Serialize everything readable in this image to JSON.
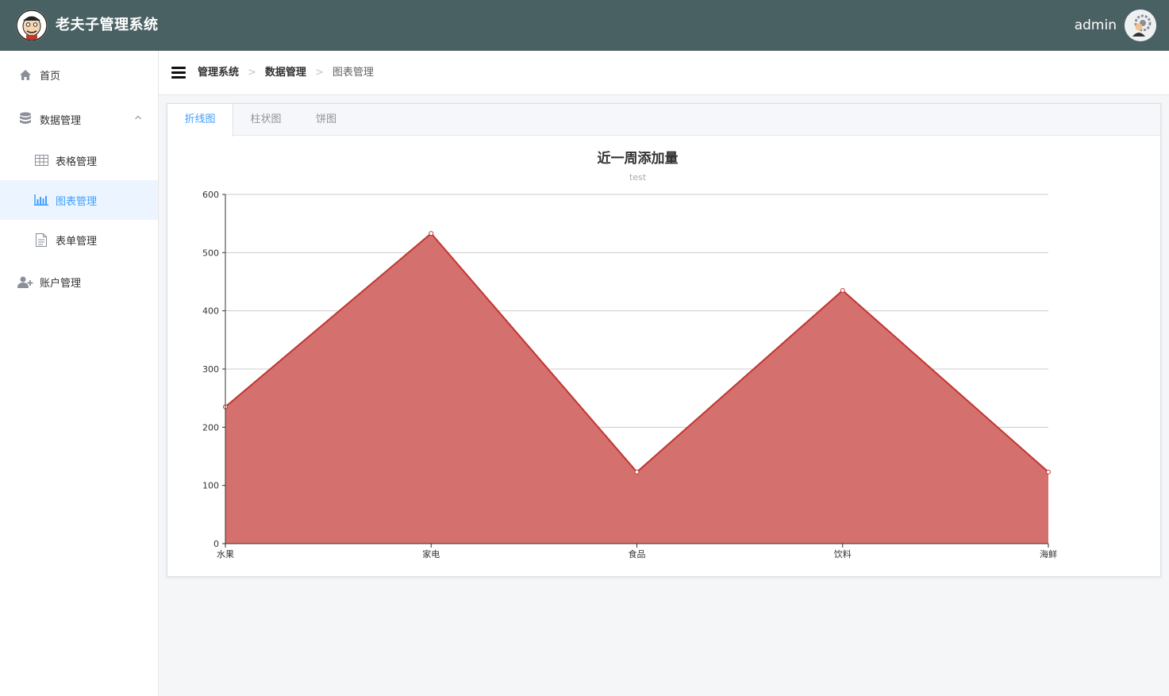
{
  "header": {
    "app_title": "老夫子管理系统",
    "username": "admin",
    "bg_color": "#4a6163"
  },
  "sidebar": {
    "items": [
      {
        "label": "首页",
        "icon": "home-icon"
      },
      {
        "label": "数据管理",
        "icon": "database-icon",
        "expanded": true
      },
      {
        "label": "表格管理",
        "icon": "table-icon"
      },
      {
        "label": "图表管理",
        "icon": "bar-chart-icon",
        "active": true
      },
      {
        "label": "表单管理",
        "icon": "document-icon"
      },
      {
        "label": "账户管理",
        "icon": "user-add-icon"
      }
    ]
  },
  "breadcrumb": [
    "管理系统",
    "数据管理",
    "图表管理"
  ],
  "tabs": [
    {
      "label": "折线图",
      "active": true
    },
    {
      "label": "柱状图"
    },
    {
      "label": "饼图"
    }
  ],
  "chart_data": {
    "type": "area",
    "title": "近一周添加量",
    "subtitle": "test",
    "categories": [
      "水果",
      "家电",
      "食品",
      "饮料",
      "海鲜"
    ],
    "series": [
      {
        "values": [
          235,
          533,
          123,
          435,
          123
        ],
        "color": "#c23531"
      }
    ],
    "ylim": [
      0,
      600
    ],
    "yticks": [
      0,
      100,
      200,
      300,
      400,
      500,
      600
    ],
    "grid": true
  },
  "colors": {
    "accent": "#409eff",
    "active_bg": "#ecf5ff",
    "series_line": "#c23531",
    "series_fill": "#d4706d"
  }
}
